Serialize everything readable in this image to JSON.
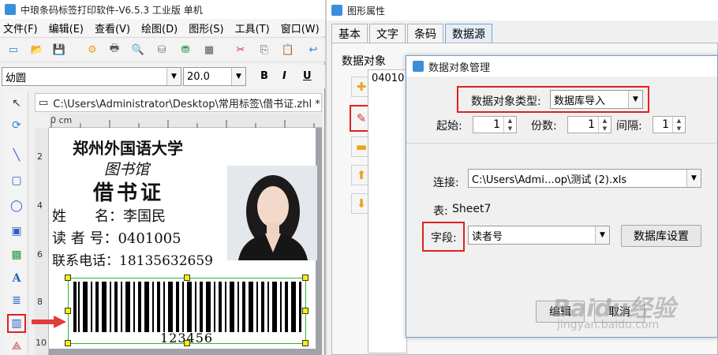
{
  "app": {
    "title": "中琅条码标签打印软件-V6.5.3 工业版 单机",
    "menu": [
      "文件(F)",
      "编辑(E)",
      "查看(V)",
      "绘图(D)",
      "图形(S)",
      "工具(T)",
      "窗口(W)"
    ],
    "font_name": "幼圆",
    "font_size": "20.0",
    "bold": "B",
    "italic": "I",
    "underline": "U",
    "doc_tab": "C:\\Users\\Administrator\\Desktop\\常用标签\\借书证.zhl *",
    "ruler_zero": "0 cm",
    "vruler_numbers": [
      "2",
      "4",
      "6",
      "8",
      "10"
    ]
  },
  "label": {
    "line1": "郑州外国语大学",
    "line2": "图书馆",
    "line3": "借书证",
    "name_row": "姓　　名：李国民",
    "reader_row": "读 者 号：0401005",
    "phone_row": "联系电话：18135632659",
    "barcode_text": "123456"
  },
  "props": {
    "title": "图形属性",
    "tabs": [
      "基本",
      "文字",
      "条码",
      "数据源"
    ],
    "group_label": "数据对象",
    "list_value": "04010"
  },
  "dialog": {
    "title": "数据对象管理",
    "type_label": "数据对象类型:",
    "type_value": "数据库导入",
    "start_label": "起始:",
    "start_value": "1",
    "copies_label": "份数:",
    "copies_value": "1",
    "interval_label": "间隔:",
    "interval_value": "1",
    "conn_label": "连接:",
    "conn_value": "C:\\Users\\Admi…op\\测试 (2).xls",
    "table_label": "表:",
    "table_value": "Sheet7",
    "field_label": "字段:",
    "field_value": "读者号",
    "db_settings_btn": "数据库设置",
    "ok_btn": "编辑",
    "cancel_btn": "取消"
  },
  "watermark": {
    "brand": "Baidu经验",
    "url": "jingyan.baidu.com"
  },
  "colors": {
    "highlight": "#e02020",
    "selection": "#2db62d",
    "handle": "#ffee00"
  }
}
